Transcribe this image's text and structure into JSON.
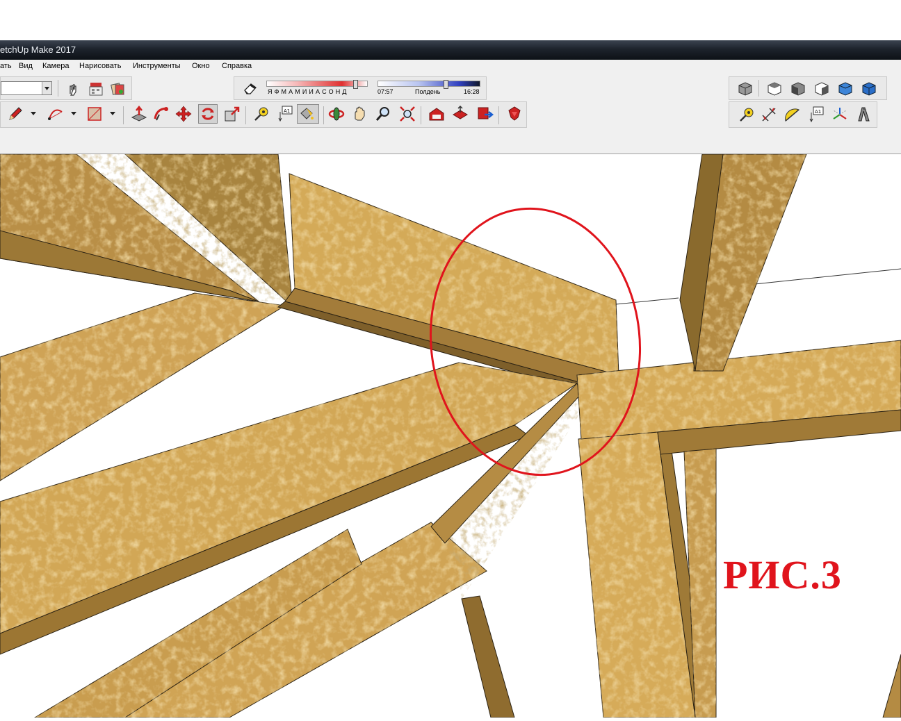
{
  "window": {
    "title": "etchUp Make 2017"
  },
  "menu": [
    "ать",
    "Вид",
    "Камера",
    "Нарисовать",
    "Инструменты",
    "Окно",
    "Справка"
  ],
  "shadows": {
    "months_label": "Я Ф М А М И И А С О Н Д",
    "time_start": "07:57",
    "time_mid": "Полдень",
    "time_end": "16:28"
  },
  "icons": {
    "row1_left": [
      "hand-select-icon",
      "components-icon",
      "materials-icon"
    ],
    "row2_left": [
      "pencil-icon",
      "arc-icon",
      "rectangle-icon",
      "push-pull-icon",
      "follow-me-icon",
      "move-icon",
      "rotate-icon",
      "scale-icon",
      "tape-measure-icon",
      "text-icon",
      "paint-bucket-icon",
      "orbit-icon",
      "pan-icon",
      "zoom-icon",
      "zoom-extents-icon",
      "warehouse-icon",
      "share-model-icon",
      "upload-icon",
      "extension-warehouse-icon"
    ],
    "row1_right": [
      "views-iso-icon",
      "view-top-icon",
      "view-front-icon",
      "view-right-icon",
      "view-back-icon",
      "view-left-icon"
    ],
    "row2_right": [
      "tape-measure-icon",
      "dimension-icon",
      "protractor-icon",
      "text-icon",
      "axes-icon",
      "3d-text-icon"
    ]
  },
  "colors": {
    "accent_red": "#e0141c",
    "wood": "#d7ad5a",
    "wood_dark": "#a37c3a"
  },
  "caption": "РИС.3"
}
